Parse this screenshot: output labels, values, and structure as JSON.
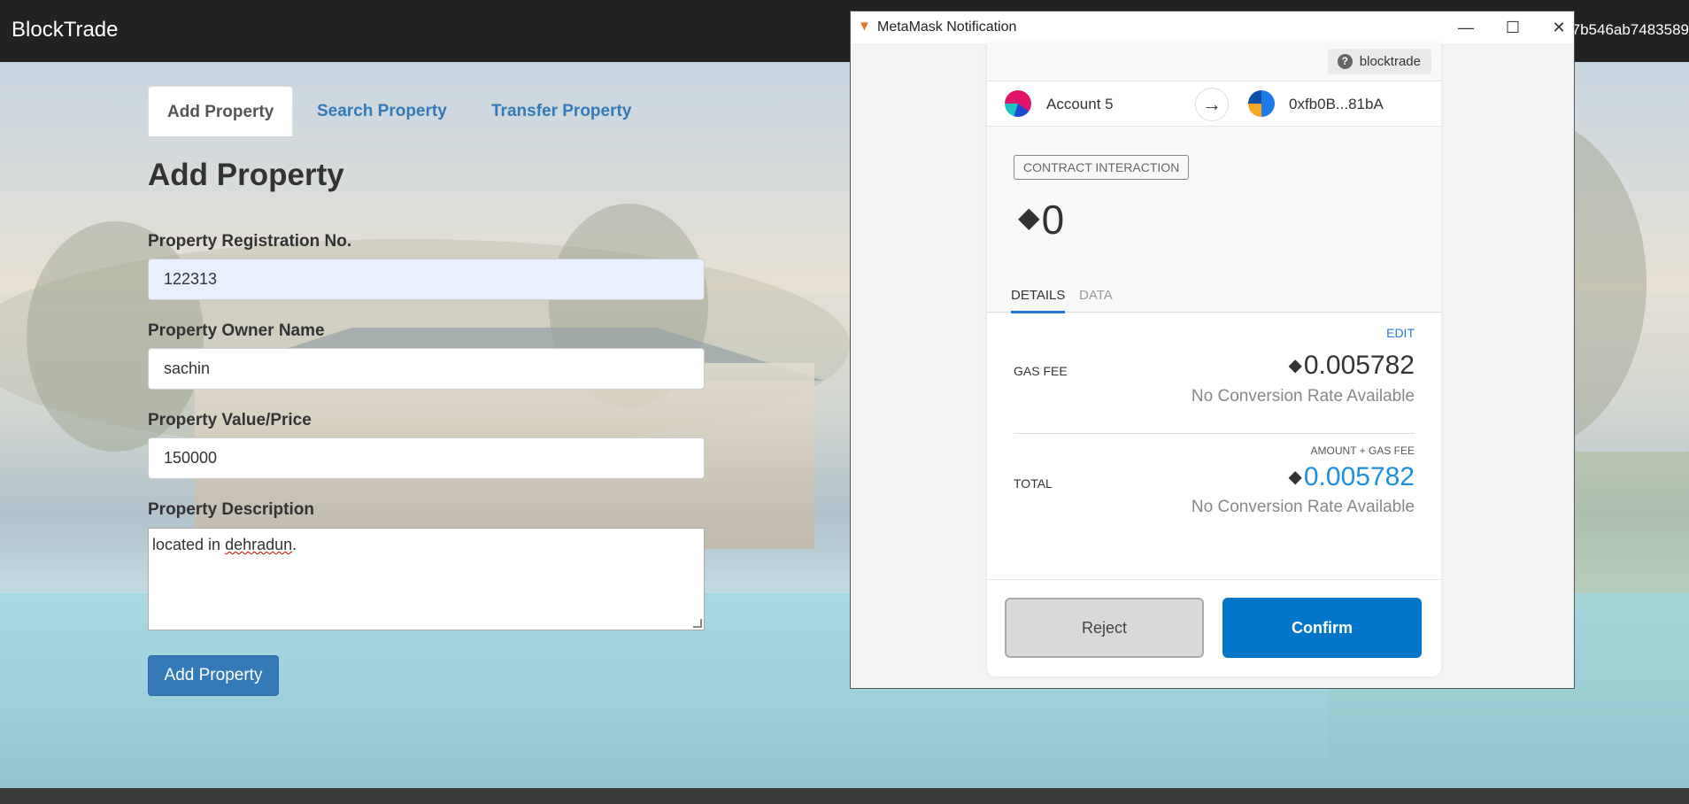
{
  "app": {
    "brand": "BlockTrade",
    "account_address": "7b546ab7483589"
  },
  "tabs": [
    {
      "label": "Add Property"
    },
    {
      "label": "Search Property"
    },
    {
      "label": "Transfer Property"
    }
  ],
  "form": {
    "heading": "Add Property",
    "reg_label": "Property Registration No.",
    "reg_value": "122313",
    "owner_label": "Property Owner Name",
    "owner_value": "sachin",
    "price_label": "Property Value/Price",
    "price_value": "150000",
    "desc_label": "Property Description",
    "desc_value_prefix": "located in ",
    "desc_value_misspelled": "dehradun",
    "desc_value_suffix": ".",
    "submit_label": "Add Property"
  },
  "metamask": {
    "window_title": "MetaMask Notification",
    "window_controls": {
      "minimize": "—",
      "maximize": "☐",
      "close": "✕"
    },
    "origin": "blocktrade",
    "from_account": "Account 5",
    "to_address": "0xfb0B...81bA",
    "tx_type": "CONTRACT INTERACTION",
    "amount": "0",
    "detail_tabs": [
      "DETAILS",
      "DATA"
    ],
    "edit_label": "EDIT",
    "gas_fee_label": "GAS FEE",
    "gas_fee_value": "0.005782",
    "gas_fee_conversion": "No Conversion Rate Available",
    "total_caption": "AMOUNT + GAS FEE",
    "total_label": "TOTAL",
    "total_value": "0.005782",
    "total_conversion": "No Conversion Rate Available",
    "reject_label": "Reject",
    "confirm_label": "Confirm"
  },
  "colors": {
    "topbar": "#222222",
    "link_blue": "#337ab7",
    "metamask_blue": "#0376c9",
    "total_blue": "#1f8fdc"
  }
}
